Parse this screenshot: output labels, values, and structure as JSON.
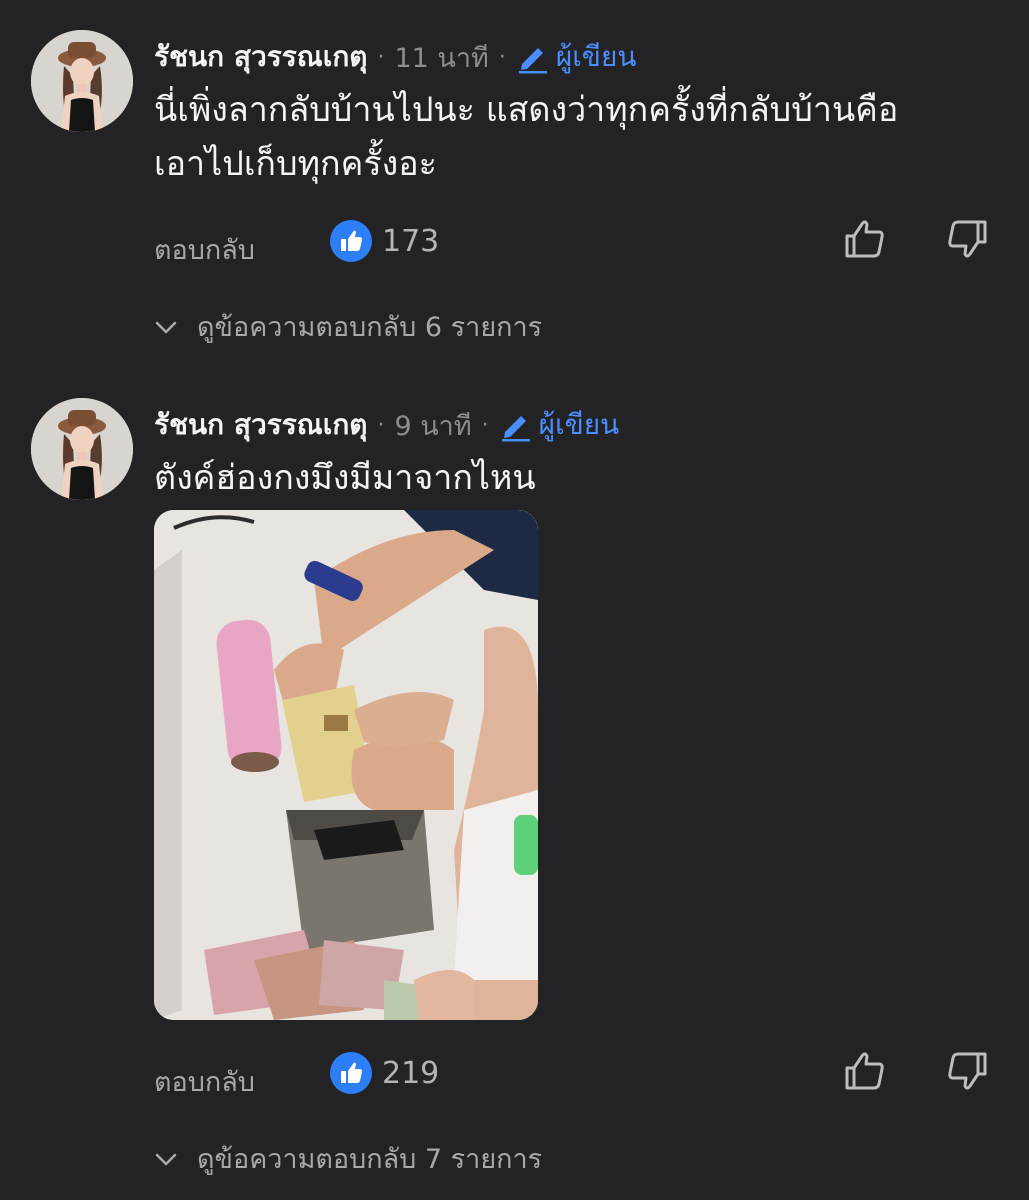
{
  "comments": [
    {
      "author": "รัชนก สุวรรณเกตุ",
      "time": "11 นาที",
      "author_label": "ผู้เขียน",
      "text_line1": "นี่เพิ่งลากลับบ้านไปนะ แสดงว่าทุกครั้งที่กลับบ้านคือ",
      "text_line2": "เอาไปเก็บทุกครั้งอะ",
      "reply_label": "ตอบกลับ",
      "likes": "173",
      "view_replies": "ดูข้อความตอบกลับ 6 รายการ"
    },
    {
      "author": "รัชนก สุวรรณเกตุ",
      "time": "9 นาที",
      "author_label": "ผู้เขียน",
      "text_line1": "ตังค์ฮ่องกงมึงมีมาจากไหน",
      "reply_label": "ตอบกลับ",
      "likes": "219",
      "view_replies": "ดูข้อความตอบกลับ 7 รายการ"
    }
  ],
  "meta_separator": "·",
  "colors": {
    "background": "#232325",
    "accent_blue": "#4a8eff",
    "like_blue": "#2d7ff9",
    "muted_text": "#8d8d90"
  },
  "icons": {
    "author_badge": "pencil-icon",
    "like_badge": "thumbs-up-filled-icon",
    "like_button": "thumbs-up-outline-icon",
    "dislike_button": "thumbs-down-outline-icon",
    "expand": "chevron-down-icon"
  }
}
